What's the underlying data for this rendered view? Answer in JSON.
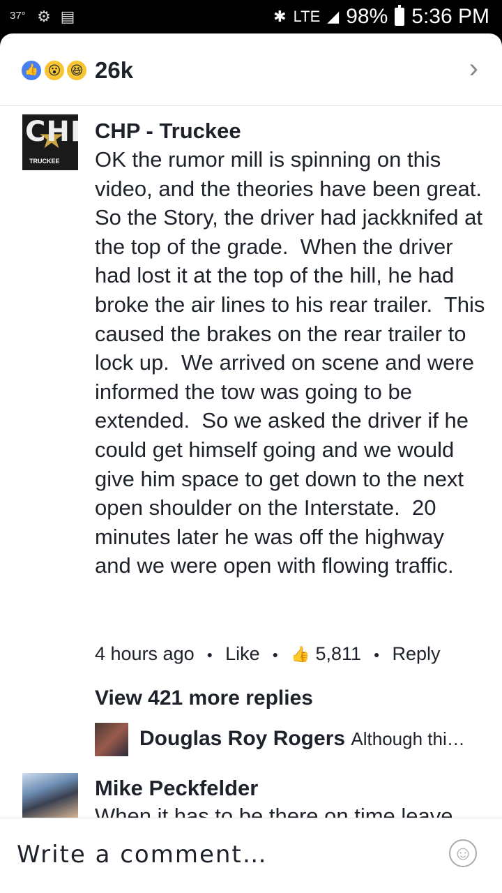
{
  "status_bar": {
    "temperature": "37°",
    "network": "LTE",
    "battery": "98%",
    "time": "5:36 PM",
    "icons": [
      "notification-icon",
      "cast-icon",
      "bluetooth-icon",
      "signal-icon",
      "battery-icon"
    ]
  },
  "reactions": {
    "types": [
      "like",
      "wow",
      "haha"
    ],
    "count": "26k"
  },
  "comment": {
    "author": "CHP - Truckee",
    "avatar_text": "CHP",
    "avatar_subtext": "TRUCKEE",
    "body": "OK the rumor mill is spinning on this video, and the theories have been great.  So the Story, the driver had jackknifed at the top of the grade.  When the driver had lost it at the top of the hill, he had broke the air lines to his rear trailer.  This caused the brakes on the rear trailer to lock up.  We arrived on scene and were informed the tow was going to be extended.  So we asked the driver if he could get himself going and we would give him space to get down to the next open shoulder on the Interstate.  20 minutes later he was off the highway and we were open with flowing traffic.",
    "time": "4 hours ago",
    "like_label": "Like",
    "like_count": "5,811",
    "reply_label": "Reply"
  },
  "more_replies": "View 421 more replies",
  "reply_preview": {
    "author": "Douglas Roy Rogers",
    "text": "Although thi…"
  },
  "next_comment": {
    "author": "Mike Peckfelder",
    "text": "When it has to be there on time leave"
  },
  "composer": {
    "placeholder": "Write a comment…"
  }
}
